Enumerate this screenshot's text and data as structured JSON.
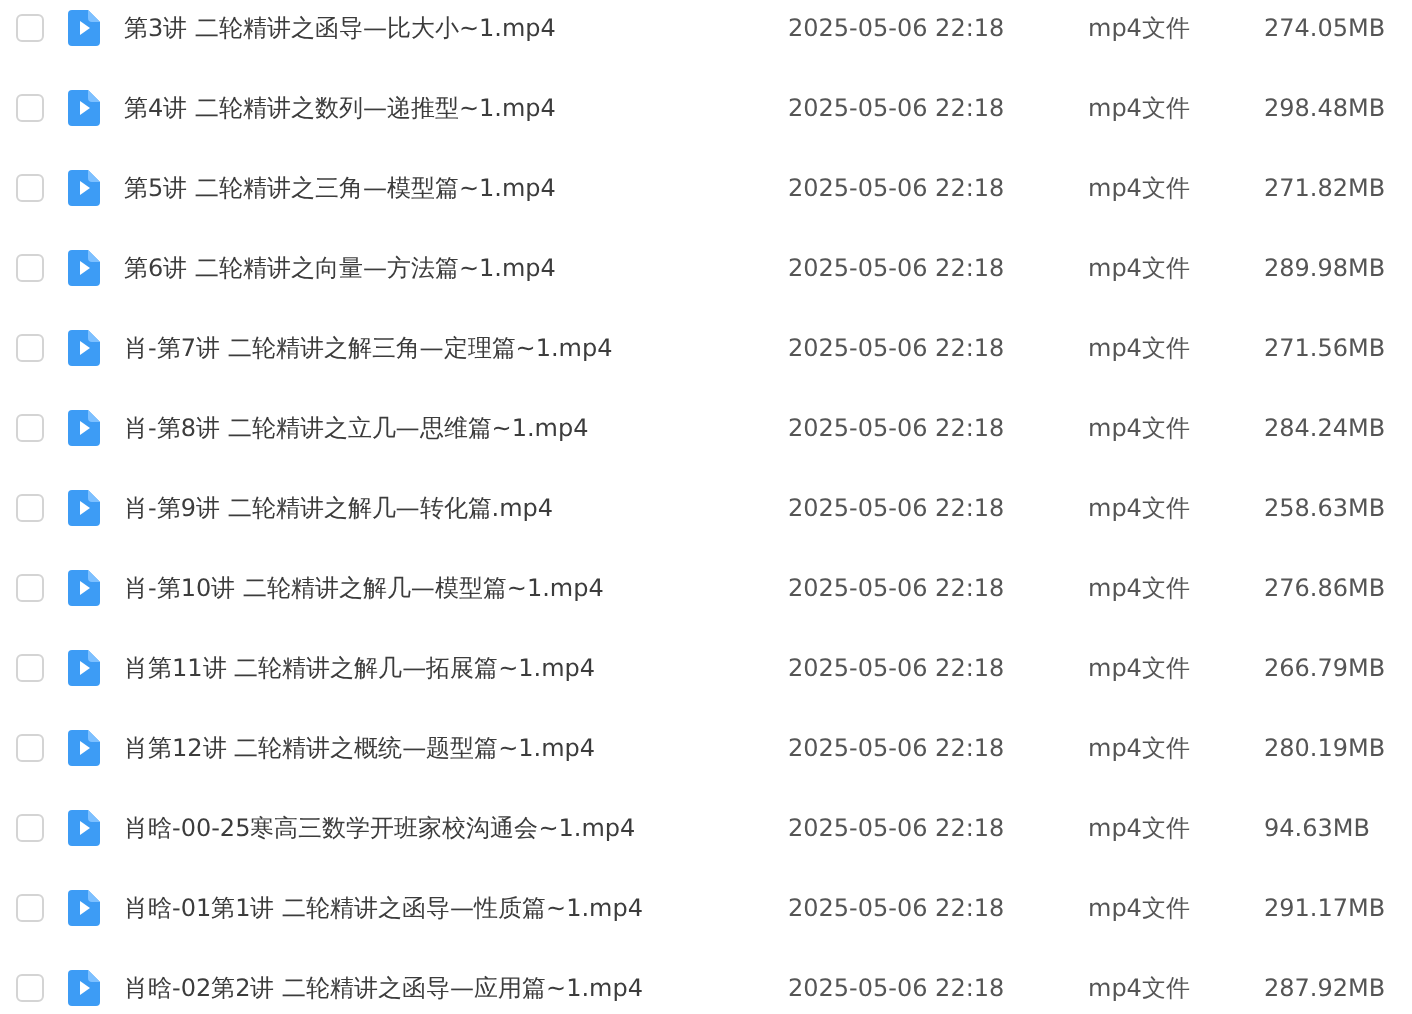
{
  "files": [
    {
      "checked": false,
      "name": "第3讲 二轮精讲之函导—比大小~1.mp4",
      "modified": "2025-05-06 22:18",
      "type": "mp4文件",
      "size": "274.05MB"
    },
    {
      "checked": false,
      "name": "第4讲 二轮精讲之数列—递推型~1.mp4",
      "modified": "2025-05-06 22:18",
      "type": "mp4文件",
      "size": "298.48MB"
    },
    {
      "checked": false,
      "name": "第5讲 二轮精讲之三角—模型篇~1.mp4",
      "modified": "2025-05-06 22:18",
      "type": "mp4文件",
      "size": "271.82MB"
    },
    {
      "checked": false,
      "name": "第6讲 二轮精讲之向量—方法篇~1.mp4",
      "modified": "2025-05-06 22:18",
      "type": "mp4文件",
      "size": "289.98MB"
    },
    {
      "checked": false,
      "name": "肖-第7讲 二轮精讲之解三角—定理篇~1.mp4",
      "modified": "2025-05-06 22:18",
      "type": "mp4文件",
      "size": "271.56MB"
    },
    {
      "checked": false,
      "name": "肖-第8讲 二轮精讲之立几—思维篇~1.mp4",
      "modified": "2025-05-06 22:18",
      "type": "mp4文件",
      "size": "284.24MB"
    },
    {
      "checked": false,
      "name": "肖-第9讲 二轮精讲之解几—转化篇.mp4",
      "modified": "2025-05-06 22:18",
      "type": "mp4文件",
      "size": "258.63MB"
    },
    {
      "checked": false,
      "name": "肖-第10讲 二轮精讲之解几—模型篇~1.mp4",
      "modified": "2025-05-06 22:18",
      "type": "mp4文件",
      "size": "276.86MB"
    },
    {
      "checked": false,
      "name": "肖第11讲 二轮精讲之解几—拓展篇~1.mp4",
      "modified": "2025-05-06 22:18",
      "type": "mp4文件",
      "size": "266.79MB"
    },
    {
      "checked": false,
      "name": "肖第12讲 二轮精讲之概统—题型篇~1.mp4",
      "modified": "2025-05-06 22:18",
      "type": "mp4文件",
      "size": "280.19MB"
    },
    {
      "checked": false,
      "name": "肖晗-00-25寒高三数学开班家校沟通会~1.mp4",
      "modified": "2025-05-06 22:18",
      "type": "mp4文件",
      "size": "94.63MB"
    },
    {
      "checked": false,
      "name": "肖晗-01第1讲 二轮精讲之函导—性质篇~1.mp4",
      "modified": "2025-05-06 22:18",
      "type": "mp4文件",
      "size": "291.17MB"
    },
    {
      "checked": false,
      "name": "肖晗-02第2讲 二轮精讲之函导—应用篇~1.mp4",
      "modified": "2025-05-06 22:18",
      "type": "mp4文件",
      "size": "287.92MB"
    }
  ]
}
